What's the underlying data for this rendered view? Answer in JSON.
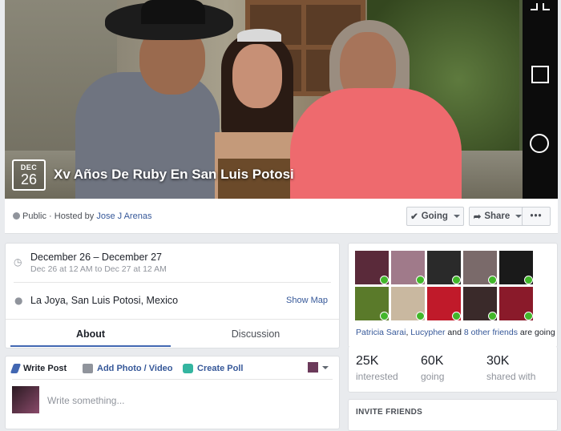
{
  "cover": {
    "date_month": "DEC",
    "date_day": "26",
    "title": "Xv Años De Ruby En San Luis Potosi"
  },
  "host": {
    "privacy": "Public",
    "hosted_by_prefix": "Hosted by",
    "host_name": "Jose J Arenas"
  },
  "actions": {
    "going_label": "Going",
    "share_label": "Share",
    "more_label": "•••"
  },
  "details": {
    "date_range": "December 26 – December 27",
    "time_range": "Dec 26 at 12 AM to Dec 27 at 12 AM",
    "location": "La Joya, San Luis Potosi, Mexico",
    "show_map": "Show Map"
  },
  "tabs": {
    "about": "About",
    "discussion": "Discussion"
  },
  "composer": {
    "write_post": "Write Post",
    "add_photo": "Add Photo / Video",
    "create_poll": "Create Poll",
    "placeholder": "Write something..."
  },
  "friends": {
    "friend1": "Patricia Sarai",
    "separator": ", ",
    "friend2": "Lucypher",
    "and_text": " and ",
    "others": "8 other friends",
    "suffix": " are going",
    "avatars": [
      {
        "color": "#5a2a3a"
      },
      {
        "color": "#a07a8a"
      },
      {
        "color": "#2a2a2a"
      },
      {
        "color": "#7a6a6a"
      },
      {
        "color": "#1a1a1a"
      },
      {
        "color": "#5a7a2a"
      },
      {
        "color": "#c9b8a0"
      },
      {
        "color": "#c01a2a"
      },
      {
        "color": "#3a2a2a"
      },
      {
        "color": "#8a1a2a"
      }
    ]
  },
  "stats": {
    "interested_count": "25K",
    "interested_label": "interested",
    "going_count": "60K",
    "going_label": "going",
    "shared_count": "30K",
    "shared_label": "shared with"
  },
  "invite": {
    "title": "INVITE FRIENDS"
  }
}
